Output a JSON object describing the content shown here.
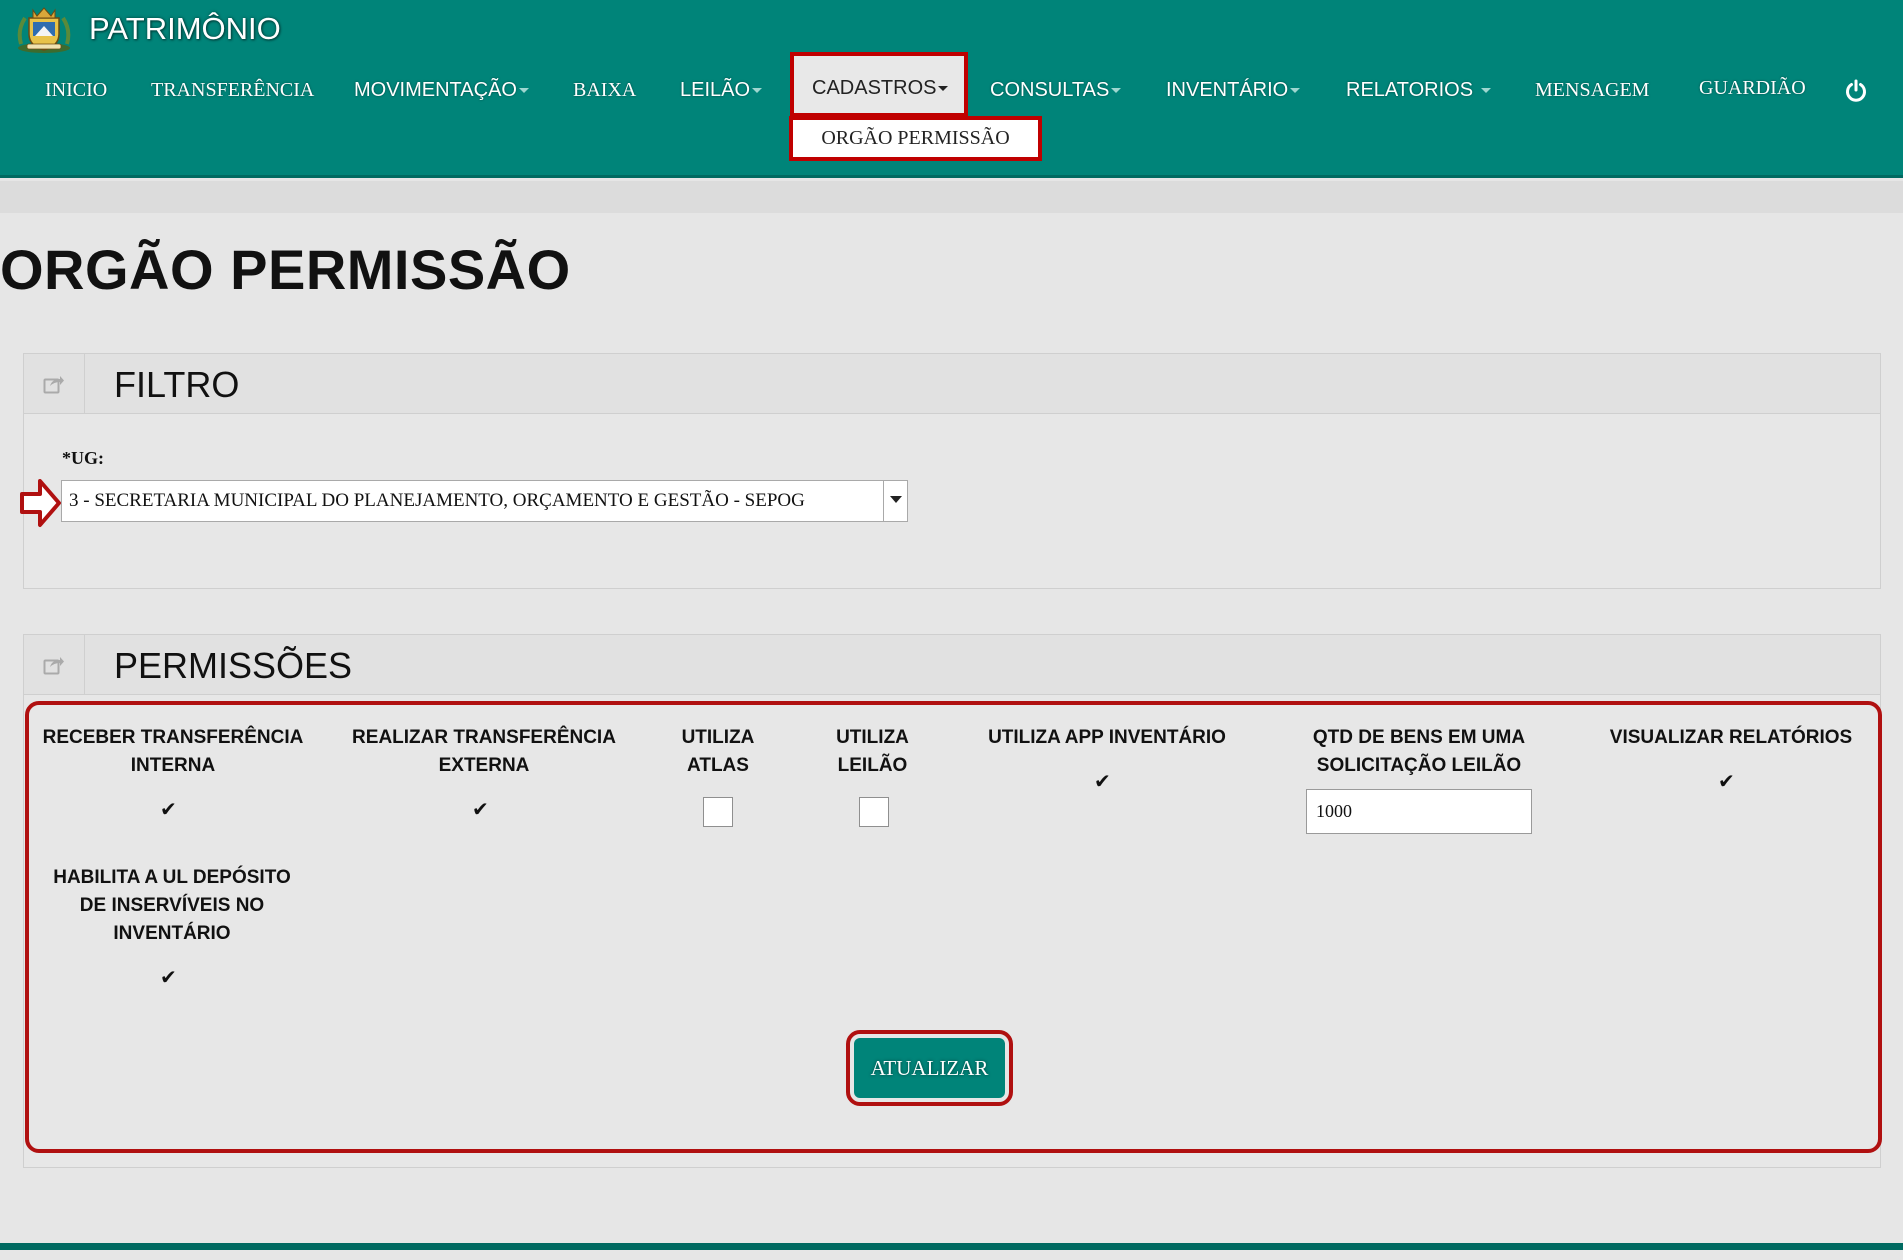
{
  "app": {
    "title": "PATRIMÔNIO",
    "logo_icon": "coat-of-arms-icon"
  },
  "nav": {
    "items": [
      {
        "label": "INICIO",
        "dropdown": false
      },
      {
        "label": "TRANSFERÊNCIA",
        "dropdown": false
      },
      {
        "label": "MOVIMENTAÇÃO",
        "dropdown": true
      },
      {
        "label": "BAIXA",
        "dropdown": false
      },
      {
        "label": "LEILÃO",
        "dropdown": true
      },
      {
        "label": "CADASTROS",
        "dropdown": true,
        "active": true
      },
      {
        "label": "CONSULTAS",
        "dropdown": true
      },
      {
        "label": "INVENTÁRIO",
        "dropdown": true
      },
      {
        "label": "RELATORIOS",
        "dropdown": true
      },
      {
        "label": "MENSAGEM",
        "dropdown": false
      },
      {
        "label": "GUARDIÃO",
        "dropdown": false
      }
    ],
    "dropdown_item": "ORGÃO PERMISSÃO",
    "power_icon": "power-icon"
  },
  "page": {
    "title": "ORGÃO PERMISSÃO"
  },
  "filter": {
    "title": "FILTRO",
    "ug_label": "*UG:",
    "ug_value": "3 - SECRETARIA MUNICIPAL DO PLANEJAMENTO, ORÇAMENTO E GESTÃO - SEPOG"
  },
  "permissions": {
    "title": "PERMISSÕES",
    "columns": [
      {
        "label": "RECEBER TRANSFERÊNCIA INTERNA",
        "type": "check",
        "checked": true
      },
      {
        "label": "REALIZAR TRANSFERÊNCIA EXTERNA",
        "type": "check",
        "checked": true
      },
      {
        "label": "UTILIZA ATLAS",
        "type": "checkbox",
        "checked": false
      },
      {
        "label": "UTILIZA LEILÃO",
        "type": "checkbox",
        "checked": false
      },
      {
        "label": "UTILIZA APP INVENTÁRIO",
        "type": "check",
        "checked": true
      },
      {
        "label": "QTD DE BENS EM UMA SOLICITAÇÃO LEILÃO",
        "type": "number",
        "value": "1000"
      },
      {
        "label": "VISUALIZAR RELATÓRIOS",
        "type": "check",
        "checked": true
      },
      {
        "label": "HABILITA A UL DEPÓSITO DE INSERVÍVEIS NO INVENTÁRIO",
        "type": "check",
        "checked": true
      }
    ],
    "check_glyph": "✔",
    "submit_label": "ATUALIZAR"
  },
  "colors": {
    "primary": "#008479",
    "highlight": "#c00000"
  }
}
